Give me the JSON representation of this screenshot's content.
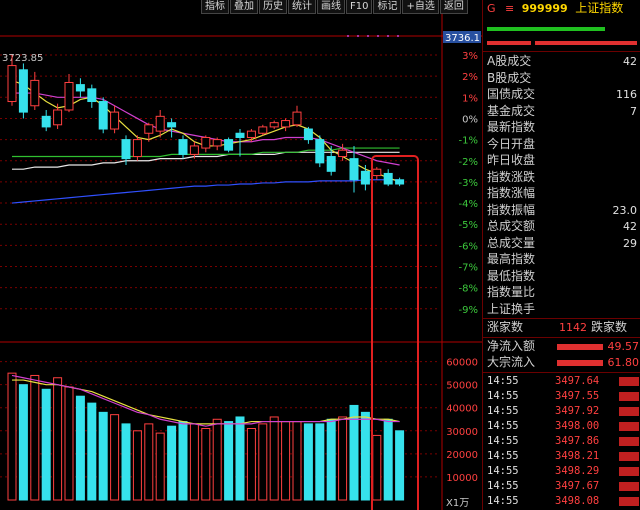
{
  "toolbar": [
    "指标",
    "叠加",
    "历史",
    "统计",
    "画线",
    "F10",
    "标记",
    "+自选",
    "返回"
  ],
  "chart": {
    "prev_close_label": "3723.85",
    "max_label": "3736.1",
    "pct_ticks": [
      "3%",
      "2%",
      "1%",
      "0%",
      "-1%",
      "-2%",
      "-3%",
      "-4%",
      "-5%",
      "-6%",
      "-7%",
      "-8%",
      "-9%"
    ],
    "vol_ticks": [
      "60000",
      "50000",
      "40000",
      "30000",
      "20000",
      "10000"
    ],
    "vol_unit": "X1万",
    "colors": {
      "up": "#ff4040",
      "down": "#36e2ec",
      "grid": "#7a0000",
      "highlight": "#e02020"
    }
  },
  "chart_data": {
    "type": "candlestick",
    "candles": [
      {
        "o": 0.8,
        "c": 2.5,
        "h": 3.0,
        "l": 0.6
      },
      {
        "o": 2.3,
        "c": 0.3,
        "h": 2.6,
        "l": 0.0
      },
      {
        "o": 0.6,
        "c": 1.8,
        "h": 2.2,
        "l": 0.4
      },
      {
        "o": 0.1,
        "c": -0.4,
        "h": 0.4,
        "l": -0.6
      },
      {
        "o": -0.3,
        "c": 0.4,
        "h": 0.7,
        "l": -0.5
      },
      {
        "o": 0.4,
        "c": 1.7,
        "h": 2.1,
        "l": 0.3
      },
      {
        "o": 1.6,
        "c": 1.3,
        "h": 1.9,
        "l": 1.0
      },
      {
        "o": 1.4,
        "c": 0.8,
        "h": 1.6,
        "l": 0.5
      },
      {
        "o": 0.8,
        "c": -0.5,
        "h": 1.0,
        "l": -0.7
      },
      {
        "o": -0.5,
        "c": 0.3,
        "h": 0.6,
        "l": -0.7
      },
      {
        "o": -1.0,
        "c": -1.9,
        "h": -0.8,
        "l": -2.2
      },
      {
        "o": -1.8,
        "c": -1.0,
        "h": -0.8,
        "l": -2.0
      },
      {
        "o": -0.7,
        "c": -0.3,
        "h": -0.2,
        "l": -1.1
      },
      {
        "o": -0.6,
        "c": 0.1,
        "h": 0.4,
        "l": -0.9
      },
      {
        "o": -0.2,
        "c": -0.4,
        "h": 0.0,
        "l": -0.9
      },
      {
        "o": -1.0,
        "c": -1.7,
        "h": -0.8,
        "l": -1.9
      },
      {
        "o": -1.7,
        "c": -1.3,
        "h": -1.1,
        "l": -1.9
      },
      {
        "o": -1.4,
        "c": -0.9,
        "h": -0.8,
        "l": -1.6
      },
      {
        "o": -1.3,
        "c": -1.0,
        "h": -0.9,
        "l": -1.5
      },
      {
        "o": -1.0,
        "c": -1.5,
        "h": -0.9,
        "l": -1.6
      },
      {
        "o": -0.7,
        "c": -0.9,
        "h": -0.5,
        "l": -1.8
      },
      {
        "o": -0.9,
        "c": -0.6,
        "h": -0.5,
        "l": -1.1
      },
      {
        "o": -0.7,
        "c": -0.4,
        "h": -0.3,
        "l": -0.8
      },
      {
        "o": -0.4,
        "c": -0.2,
        "h": -0.1,
        "l": -0.5
      },
      {
        "o": -0.4,
        "c": -0.1,
        "h": 0.0,
        "l": -0.6
      },
      {
        "o": -0.3,
        "c": 0.3,
        "h": 0.6,
        "l": -0.4
      },
      {
        "o": -0.5,
        "c": -1.0,
        "h": -0.4,
        "l": -1.2
      },
      {
        "o": -1.0,
        "c": -2.1,
        "h": -0.8,
        "l": -2.3
      },
      {
        "o": -1.8,
        "c": -2.5,
        "h": -1.3,
        "l": -2.7
      },
      {
        "o": -1.8,
        "c": -1.5,
        "h": -1.2,
        "l": -2.0
      },
      {
        "o": -1.9,
        "c": -2.9,
        "h": -1.3,
        "l": -3.5
      },
      {
        "o": -2.5,
        "c": -3.1,
        "h": -2.2,
        "l": -3.4
      },
      {
        "o": -2.7,
        "c": -2.4,
        "h": -2.3,
        "l": -2.9
      },
      {
        "o": -2.6,
        "c": -3.1,
        "h": -2.4,
        "l": -3.2
      },
      {
        "o": -2.9,
        "c": -3.1,
        "h": -2.8,
        "l": -3.2
      }
    ],
    "volume": [
      55,
      50,
      54,
      48,
      53,
      49,
      45,
      42,
      38,
      37,
      33,
      30,
      33,
      29,
      32,
      34,
      33,
      31,
      35,
      34,
      36,
      31,
      33,
      36,
      34,
      34,
      33,
      33,
      35,
      36,
      41,
      38,
      28,
      35,
      30
    ],
    "ma_short": [
      1.8,
      1.6,
      1.2,
      0.8,
      0.5,
      0.6,
      0.9,
      1.0,
      0.6,
      0.1,
      -0.4,
      -0.9,
      -1.0,
      -0.8,
      -0.5,
      -0.7,
      -1.1,
      -1.3,
      -1.3,
      -1.2,
      -1.1,
      -1.0,
      -0.8,
      -0.6,
      -0.4,
      -0.3,
      -0.5,
      -0.9,
      -1.5,
      -1.8,
      -2.1,
      -2.4,
      -2.6,
      -2.8,
      -3.0
    ],
    "ma_mid": [
      1.2,
      1.2,
      1.2,
      1.1,
      1.0,
      1.0,
      1.0,
      1.0,
      0.9,
      0.6,
      0.3,
      0.0,
      -0.3,
      -0.5,
      -0.6,
      -0.7,
      -0.8,
      -0.9,
      -1.0,
      -1.1,
      -1.1,
      -1.1,
      -1.0,
      -1.0,
      -0.9,
      -0.9,
      -0.9,
      -1.0,
      -1.2,
      -1.4,
      -1.6,
      -1.8,
      -2.0,
      -2.1,
      -2.2
    ],
    "ma_long_green": [
      -1.8,
      -1.8,
      -1.8,
      -1.8,
      -1.8,
      -1.8,
      -1.8,
      -1.8,
      -1.8,
      -1.8,
      -1.8,
      -1.8,
      -1.8,
      -1.8,
      -1.7,
      -1.7,
      -1.7,
      -1.7,
      -1.7,
      -1.7,
      -1.7,
      -1.7,
      -1.6,
      -1.6,
      -1.6,
      -1.6,
      -1.5,
      -1.5,
      -1.5,
      -1.4,
      -1.4,
      -1.4,
      -1.4,
      -1.4,
      -1.4
    ],
    "ma_white": [
      -2.4,
      -2.4,
      -2.3,
      -2.3,
      -2.3,
      -2.2,
      -2.2,
      -2.2,
      -2.1,
      -2.1,
      -2.0,
      -2.0,
      -2.0,
      -1.9,
      -1.9,
      -1.9,
      -1.8,
      -1.8,
      -1.8,
      -1.7,
      -1.7,
      -1.7,
      -1.7,
      -1.7,
      -1.6,
      -1.6,
      -1.6,
      -1.6,
      -1.6,
      -1.6,
      -1.6,
      -1.6,
      -1.6,
      -1.6,
      -1.6
    ],
    "ma_blue": [
      -4.0,
      -3.95,
      -3.9,
      -3.85,
      -3.8,
      -3.75,
      -3.7,
      -3.65,
      -3.6,
      -3.55,
      -3.5,
      -3.45,
      -3.4,
      -3.35,
      -3.3,
      -3.25,
      -3.2,
      -3.2,
      -3.15,
      -3.15,
      -3.1,
      -3.1,
      -3.05,
      -3.05,
      -3.0,
      -3.0,
      -3.0,
      -2.95,
      -2.95,
      -2.95,
      -2.95,
      -2.9,
      -2.9,
      -2.9,
      -2.9
    ],
    "vol_ma_a": [
      52,
      52,
      51,
      50,
      50,
      49,
      48,
      47,
      45,
      43,
      41,
      39,
      37,
      36,
      35,
      34,
      33,
      33,
      33,
      33,
      33,
      34,
      34,
      34,
      34,
      34,
      34,
      34,
      35,
      35,
      36,
      36,
      35,
      35,
      34
    ],
    "vol_ma_b": [
      54,
      53,
      52,
      51,
      50,
      49,
      48,
      46,
      44,
      42,
      40,
      38,
      37,
      35,
      34,
      33,
      33,
      32,
      33,
      33,
      33,
      33,
      34,
      34,
      34,
      34,
      34,
      34,
      34,
      35,
      35,
      35,
      35,
      34,
      34
    ],
    "ylim": [
      -9.5,
      3.5
    ],
    "vol_ylim": [
      0,
      65
    ]
  },
  "panel": {
    "head": {
      "g": "G",
      "eq": "≡",
      "code": "999999",
      "name": "上证指数"
    },
    "stats": [
      {
        "label": "A股成交",
        "value": "42"
      },
      {
        "label": "B股成交",
        "value": ""
      },
      {
        "label": "国债成交",
        "value": "116"
      },
      {
        "label": "基金成交",
        "value": "7"
      },
      {
        "label": "最新指数",
        "value": ""
      },
      {
        "label": "今日开盘",
        "value": ""
      },
      {
        "label": "昨日收盘",
        "value": ""
      },
      {
        "label": "指数涨跌",
        "value": ""
      },
      {
        "label": "指数涨幅",
        "value": ""
      },
      {
        "label": "指数振幅",
        "value": "23.0"
      },
      {
        "label": "总成交额",
        "value": "42"
      },
      {
        "label": "总成交量",
        "value": "29"
      },
      {
        "label": "最高指数",
        "value": ""
      },
      {
        "label": "最低指数",
        "value": ""
      },
      {
        "label": "指数量比",
        "value": ""
      },
      {
        "label": "上证换手",
        "value": ""
      }
    ],
    "updown": {
      "up_label": "涨家数",
      "up_value": "1142",
      "down_label": "跌家数"
    },
    "flows": [
      {
        "label": "净流入额",
        "value": "49.57"
      },
      {
        "label": "大宗流入",
        "value": "61.80"
      }
    ],
    "ticks": [
      {
        "time": "14:55",
        "price": "3497.64"
      },
      {
        "time": "14:55",
        "price": "3497.55"
      },
      {
        "time": "14:55",
        "price": "3497.92"
      },
      {
        "time": "14:55",
        "price": "3498.00"
      },
      {
        "time": "14:55",
        "price": "3497.86"
      },
      {
        "time": "14:55",
        "price": "3498.21"
      },
      {
        "time": "14:55",
        "price": "3498.29"
      },
      {
        "time": "14:55",
        "price": "3497.67"
      },
      {
        "time": "14:55",
        "price": "3498.08"
      }
    ]
  }
}
